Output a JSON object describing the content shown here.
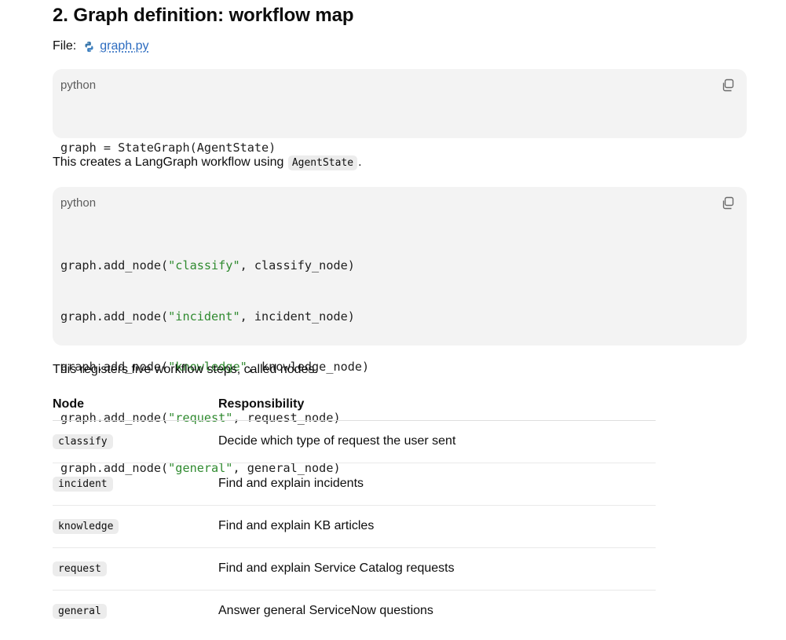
{
  "section": {
    "heading": "2. Graph definition: workflow map",
    "file_label": "File:",
    "file_icon": "python-icon",
    "file_name": "graph.py"
  },
  "code_blocks": [
    {
      "language": "python",
      "copy_icon": "copy-icon",
      "lines": [
        [
          "graph = StateGraph(AgentState)"
        ]
      ]
    },
    {
      "language": "python",
      "copy_icon": "copy-icon",
      "lines": [
        [
          "graph.add_node(",
          "\"classify\"",
          ", classify_node)"
        ],
        [
          "graph.add_node(",
          "\"incident\"",
          ", incident_node)"
        ],
        [
          "graph.add_node(",
          "\"knowledge\"",
          ", knowledge_node)"
        ],
        [
          "graph.add_node(",
          "\"request\"",
          ", request_node)"
        ],
        [
          "graph.add_node(",
          "\"general\"",
          ", general_node)"
        ]
      ]
    }
  ],
  "para1": {
    "before": "This creates a LangGraph workflow using",
    "code": "AgentState",
    "after": "."
  },
  "para2": "This registers five workflow steps, called nodes.",
  "table": {
    "headers": [
      "Node",
      "Responsibility"
    ],
    "rows": [
      [
        "classify",
        "Decide which type of request the user sent"
      ],
      [
        "incident",
        "Find and explain incidents"
      ],
      [
        "knowledge",
        "Find and explain KB articles"
      ],
      [
        "request",
        "Find and explain Service Catalog requests"
      ],
      [
        "general",
        "Answer general ServiceNow questions"
      ]
    ]
  },
  "colors": {
    "link": "#2d6cc0",
    "string": "#2f8a2f",
    "code_bg": "#f3f3f3"
  }
}
